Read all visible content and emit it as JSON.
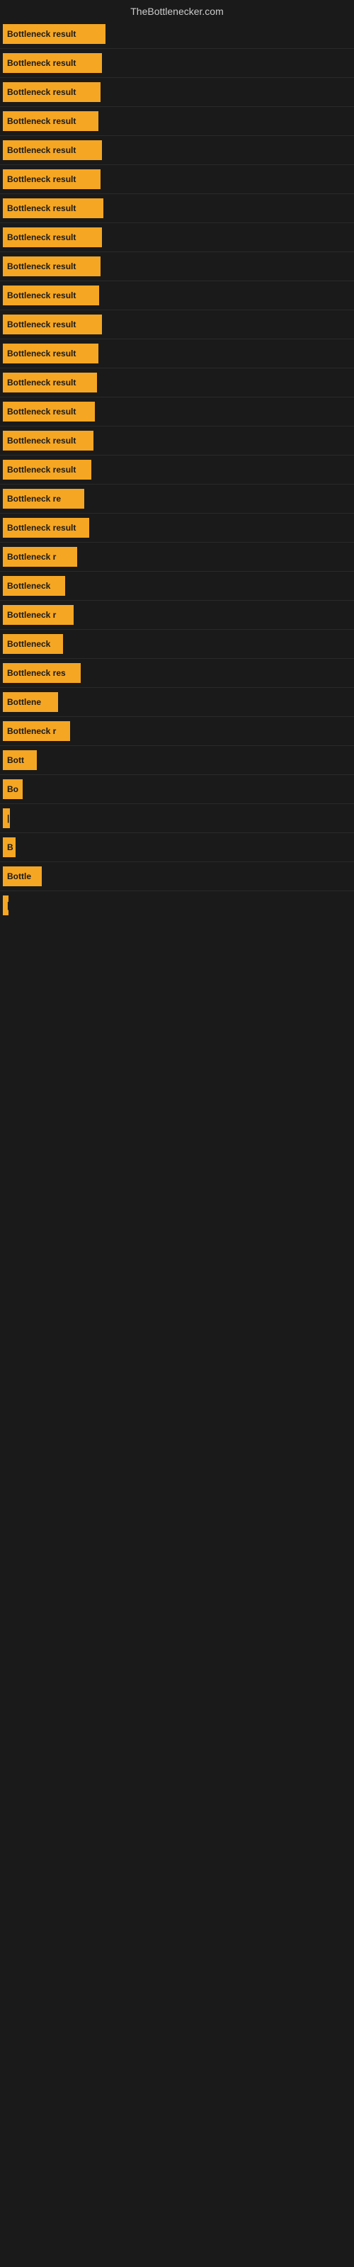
{
  "header": {
    "title": "TheBottlenecker.com"
  },
  "bars": [
    {
      "label": "Bottleneck result",
      "width": 145
    },
    {
      "label": "Bottleneck result",
      "width": 140
    },
    {
      "label": "Bottleneck result",
      "width": 138
    },
    {
      "label": "Bottleneck result",
      "width": 135
    },
    {
      "label": "Bottleneck result",
      "width": 140
    },
    {
      "label": "Bottleneck result",
      "width": 138
    },
    {
      "label": "Bottleneck result",
      "width": 142
    },
    {
      "label": "Bottleneck result",
      "width": 140
    },
    {
      "label": "Bottleneck result",
      "width": 138
    },
    {
      "label": "Bottleneck result",
      "width": 136
    },
    {
      "label": "Bottleneck result",
      "width": 140
    },
    {
      "label": "Bottleneck result",
      "width": 135
    },
    {
      "label": "Bottleneck result",
      "width": 133
    },
    {
      "label": "Bottleneck result",
      "width": 130
    },
    {
      "label": "Bottleneck result",
      "width": 128
    },
    {
      "label": "Bottleneck result",
      "width": 125
    },
    {
      "label": "Bottleneck re",
      "width": 115
    },
    {
      "label": "Bottleneck result",
      "width": 122
    },
    {
      "label": "Bottleneck r",
      "width": 105
    },
    {
      "label": "Bottleneck",
      "width": 88
    },
    {
      "label": "Bottleneck r",
      "width": 100
    },
    {
      "label": "Bottleneck",
      "width": 85
    },
    {
      "label": "Bottleneck res",
      "width": 110
    },
    {
      "label": "Bottlene",
      "width": 78
    },
    {
      "label": "Bottleneck r",
      "width": 95
    },
    {
      "label": "Bott",
      "width": 48
    },
    {
      "label": "Bo",
      "width": 28
    },
    {
      "label": "|",
      "width": 10
    },
    {
      "label": "B",
      "width": 18
    },
    {
      "label": "Bottle",
      "width": 55
    },
    {
      "label": "|",
      "width": 8
    }
  ]
}
